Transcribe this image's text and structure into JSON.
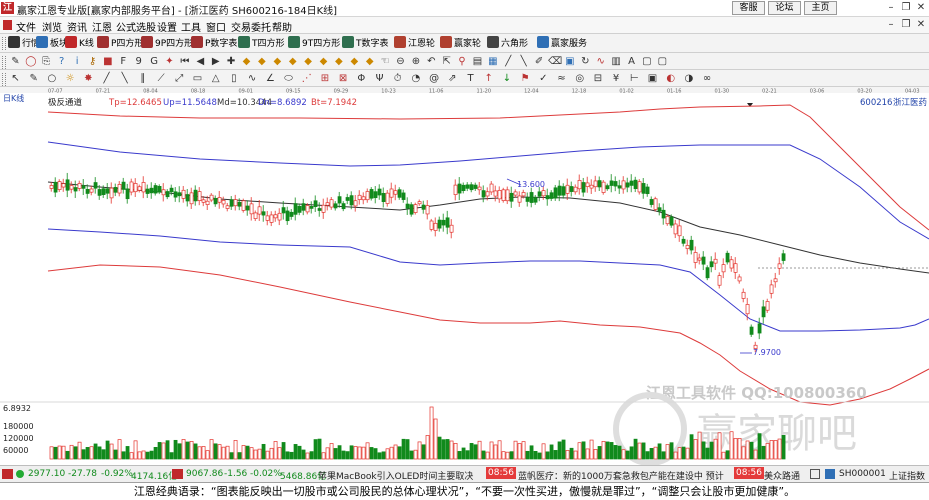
{
  "window": {
    "title": "赢家江恩专业版[赢家内部服务平台] - [浙江医药  SH600216-184日K线]",
    "logo_text": "江",
    "links": [
      "客服",
      "论坛",
      "主页"
    ]
  },
  "menu": [
    "文件",
    "浏览",
    "资讯",
    "江恩",
    "公式选股",
    "设置",
    "工具",
    "窗口",
    "交易委托",
    "帮助"
  ],
  "toolbar1": [
    {
      "label": "行情",
      "icon": "grid-icon",
      "color": "#333333"
    },
    {
      "label": "板块",
      "icon": "blocks-icon",
      "color": "#2f6fb5"
    },
    {
      "label": "K线",
      "icon": "kline-icon",
      "color": "#c0282a"
    },
    {
      "label": "P四方形",
      "icon": "p-square-icon",
      "color": "#a03030"
    },
    {
      "label": "9P四方形",
      "icon": "9p-square-icon",
      "color": "#a03030"
    },
    {
      "label": "P数字表",
      "icon": "p-table-icon",
      "color": "#a03030"
    },
    {
      "label": "T四方形",
      "icon": "t-square-icon",
      "color": "#2f6f4f"
    },
    {
      "label": "9T四方形",
      "icon": "9t-square-icon",
      "color": "#2f6f4f"
    },
    {
      "label": "T数字表",
      "icon": "t-table-icon",
      "color": "#2f6f4f"
    },
    {
      "label": "江恩轮",
      "icon": "gann-wheel-icon",
      "color": "#b0402f"
    },
    {
      "label": "赢家轮",
      "icon": "winner-wheel-icon",
      "color": "#b0402f"
    },
    {
      "label": "六角形",
      "icon": "hexagon-icon",
      "color": "#444444"
    },
    {
      "label": "赢家服务",
      "icon": "service-icon",
      "color": "#2f6fb5"
    }
  ],
  "chart": {
    "period_label": "日K线",
    "indicator": {
      "name": "极反通道",
      "tp": "Tp=12.6465",
      "up": "Up=11.5648",
      "md": "Md=10.3444",
      "dn": "Dn=8.6892",
      "bt": "Bt=7.1942"
    },
    "stock": {
      "code": "600216",
      "name": "浙江医药"
    },
    "date_ticks": [
      "07-07",
      "07-21",
      "08-04",
      "08-18",
      "09-01",
      "09-15",
      "09-29",
      "10-23",
      "11-06",
      "11-20",
      "12-04",
      "12-18",
      "01-02",
      "01-16",
      "01-30",
      "02-21",
      "03-06",
      "03-20",
      "04-03"
    ],
    "high_label": "13.600",
    "low_label": "7.9700",
    "volume_top_label": "6.8932",
    "volume_labels": [
      "180000",
      "120000",
      "60000"
    ],
    "watermark_line1": "江恩工具软件  QQ:100800360",
    "watermark_line2": "赢家聊吧",
    "colors": {
      "up_candle": "#e4322b",
      "down_candle": "#118a1c",
      "tp_line": "#dd3b3b",
      "up_line": "#3a3acc",
      "md_line": "#333333",
      "volume_up": "#e4322b",
      "volume_down": "#118a1c"
    }
  },
  "statusbar": {
    "sh_index": "2977.10",
    "sh_change": "-27.78",
    "sh_pct": "-0.92%",
    "sh_amount": "4174.16亿",
    "sz_index": "9067.86",
    "sz_change": "-1.56",
    "sz_pct": "-0.02%",
    "sz_amount": "5468.86亿",
    "news1": "苹果MacBook引入OLED时间主要取决",
    "time1": "08:56",
    "news2": "蓝帆医疗：新的1000万套急救包产能在建设中 预计",
    "time2": "08:56",
    "news3": "美众路通",
    "index_code": "SH000001",
    "index_name": "上证指数"
  },
  "quote": "江恩经典语录：“图表能反映出一切股市或公司股民的总体心理状况”，“不要一次性买进，傲慢就是罪过”，“调整只会让股市更加健康”。"
}
